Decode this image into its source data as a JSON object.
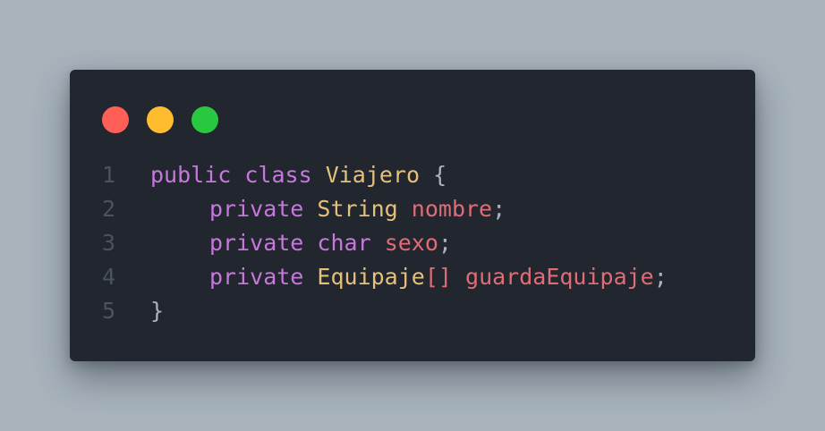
{
  "colors": {
    "background": "#a8b3bc",
    "window": "#22262e",
    "line_number": "#4b5260",
    "keyword": "#c678dd",
    "type": "#e5c07b",
    "identifier": "#e06c75",
    "punctuation": "#abb2bf",
    "dot_close": "#ff5f57",
    "dot_minimize": "#febc2e",
    "dot_maximize": "#28c840"
  },
  "window_controls": [
    "close-dot",
    "minimize-dot",
    "maximize-dot"
  ],
  "code": {
    "lines": [
      {
        "number": "1",
        "indent": false,
        "tokens": [
          {
            "text": "public",
            "kind": "keyword"
          },
          {
            "text": " ",
            "kind": "punctuation"
          },
          {
            "text": "class",
            "kind": "keyword"
          },
          {
            "text": " ",
            "kind": "punctuation"
          },
          {
            "text": "Viajero",
            "kind": "type"
          },
          {
            "text": " ",
            "kind": "punctuation"
          },
          {
            "text": "{",
            "kind": "punctuation"
          }
        ]
      },
      {
        "number": "2",
        "indent": true,
        "tokens": [
          {
            "text": "private",
            "kind": "keyword"
          },
          {
            "text": " ",
            "kind": "punctuation"
          },
          {
            "text": "String",
            "kind": "type"
          },
          {
            "text": " ",
            "kind": "punctuation"
          },
          {
            "text": "nombre",
            "kind": "identifier"
          },
          {
            "text": ";",
            "kind": "punctuation"
          }
        ]
      },
      {
        "number": "3",
        "indent": true,
        "tokens": [
          {
            "text": "private",
            "kind": "keyword"
          },
          {
            "text": " ",
            "kind": "punctuation"
          },
          {
            "text": "char",
            "kind": "keyword"
          },
          {
            "text": " ",
            "kind": "punctuation"
          },
          {
            "text": "sexo",
            "kind": "identifier"
          },
          {
            "text": ";",
            "kind": "punctuation"
          }
        ]
      },
      {
        "number": "4",
        "indent": true,
        "tokens": [
          {
            "text": "private",
            "kind": "keyword"
          },
          {
            "text": " ",
            "kind": "punctuation"
          },
          {
            "text": "Equipaje",
            "kind": "type"
          },
          {
            "text": "[]",
            "kind": "identifier"
          },
          {
            "text": " ",
            "kind": "punctuation"
          },
          {
            "text": "guardaEquipaje",
            "kind": "identifier"
          },
          {
            "text": ";",
            "kind": "punctuation"
          }
        ]
      },
      {
        "number": "5",
        "indent": false,
        "tokens": [
          {
            "text": "}",
            "kind": "punctuation"
          }
        ]
      }
    ]
  }
}
